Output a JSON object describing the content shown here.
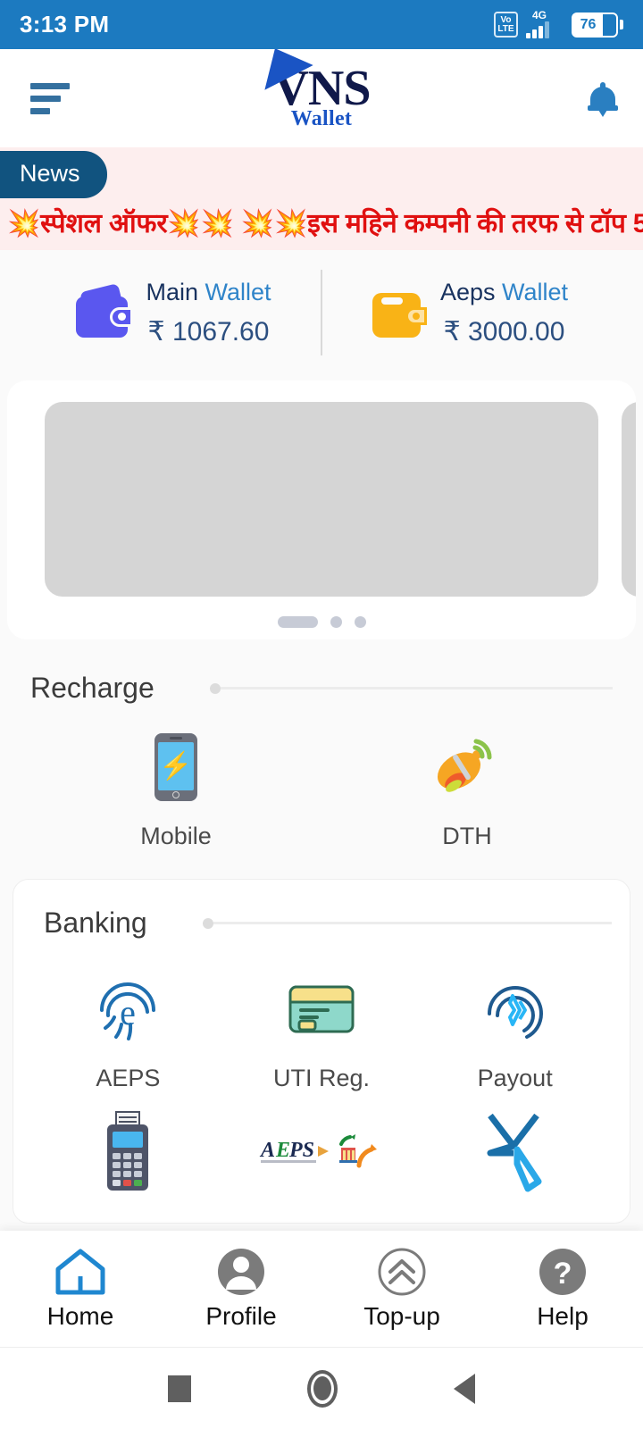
{
  "status_bar": {
    "time": "3:13 PM",
    "volte_top": "Vo",
    "volte_bottom": "LTE",
    "network": "4G",
    "battery": "76"
  },
  "app_bar": {
    "menu_icon": "hamburger-icon",
    "logo_text": "VNS",
    "logo_subtext": "Wallet",
    "notification_icon": "bell-icon"
  },
  "news": {
    "badge": "News",
    "text": "💥स्पेशल ऑफर💥💥 💥💥इस महिने कम्पनी की तरफ से टॉप 5"
  },
  "wallets": [
    {
      "name_first": "Main ",
      "name_second": "Wallet",
      "amount": "₹ 1067.60",
      "icon": "wallet-icon",
      "color": "#5a57ef"
    },
    {
      "name_first": "Aeps ",
      "name_second": "Wallet",
      "amount": "₹ 3000.00",
      "icon": "wallet-icon",
      "color": "#f9b316"
    }
  ],
  "carousel": {
    "slide_count": 3,
    "active_index": 0
  },
  "sections": [
    {
      "title": "Recharge",
      "items": [
        {
          "label": "Mobile",
          "icon": "mobile-recharge-icon"
        },
        {
          "label": "DTH",
          "icon": "satellite-dish-icon"
        }
      ]
    },
    {
      "title": "Banking",
      "items": [
        {
          "label": "AEPS",
          "icon": "fingerprint-aeps-icon"
        },
        {
          "label": "UTI Reg.",
          "icon": "card-uti-icon"
        },
        {
          "label": "Payout",
          "icon": "fingerprint-payout-icon"
        },
        {
          "label": "",
          "icon": "pos-terminal-icon"
        },
        {
          "label": "",
          "icon": "aeps-logo-icon"
        },
        {
          "label": "",
          "icon": "x-logo-icon"
        }
      ]
    }
  ],
  "bottom_nav": [
    {
      "label": "Home",
      "icon": "home-icon",
      "active": true
    },
    {
      "label": "Profile",
      "icon": "person-icon",
      "active": false
    },
    {
      "label": "Top-up",
      "icon": "chevron-up-circle-icon",
      "active": false
    },
    {
      "label": "Help",
      "icon": "question-mark-icon",
      "active": false
    }
  ],
  "android_nav": [
    {
      "icon": "recents-square-icon"
    },
    {
      "icon": "home-circle-icon"
    },
    {
      "icon": "back-triangle-icon"
    }
  ],
  "colors": {
    "status_bar": "#1c7ac0",
    "news_bg": "#fdeeee",
    "news_badge": "#11537f",
    "news_text": "#e01010",
    "accent_blue": "#2a7fc1",
    "page_bg": "#fafafa"
  }
}
